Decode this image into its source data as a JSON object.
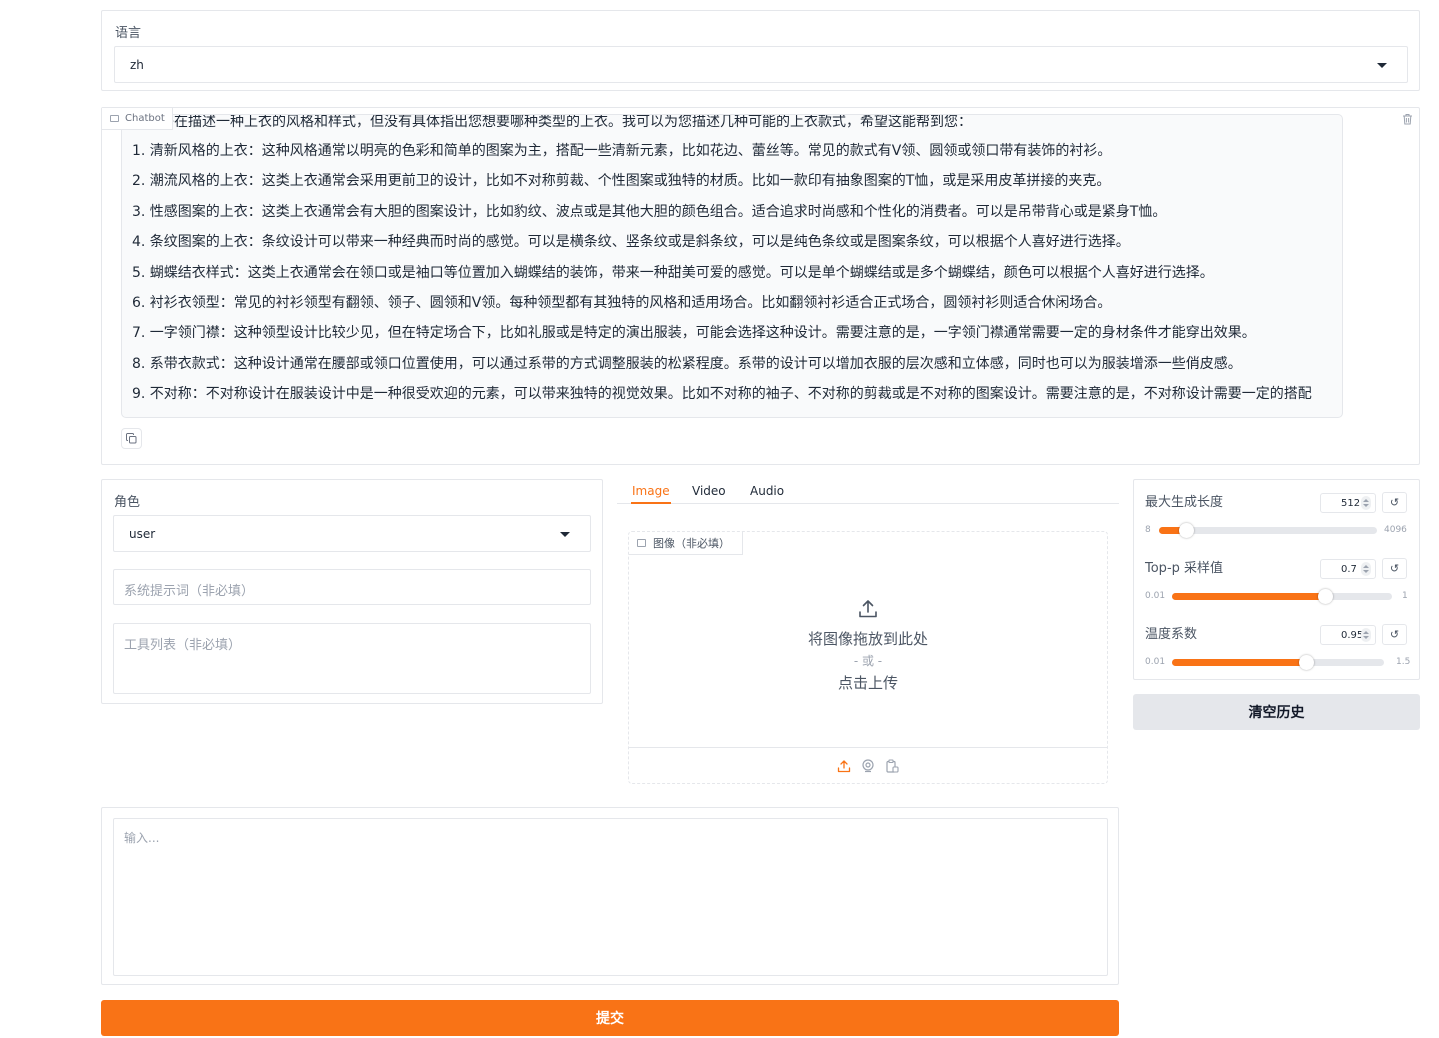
{
  "language": {
    "label": "语言",
    "value": "zh"
  },
  "chatbot": {
    "tag_label": "Chatbot",
    "intro": "您似乎在描述一种上衣的风格和样式，但没有具体指出您想要哪种类型的上衣。我可以为您描述几种可能的上衣款式，希望这能帮到您：",
    "lines": [
      "1. 清新风格的上衣：这种风格通常以明亮的色彩和简单的图案为主，搭配一些清新元素，比如花边、蕾丝等。常见的款式有V领、圆领或领口带有装饰的衬衫。",
      "2. 潮流风格的上衣：这类上衣通常会采用更前卫的设计，比如不对称剪裁、个性图案或独特的材质。比如一款印有抽象图案的T恤，或是采用皮革拼接的夹克。",
      "3. 性感图案的上衣：这类上衣通常会有大胆的图案设计，比如豹纹、波点或是其他大胆的颜色组合。适合追求时尚感和个性化的消费者。可以是吊带背心或是紧身T恤。",
      "4. 条纹图案的上衣：条纹设计可以带来一种经典而时尚的感觉。可以是横条纹、竖条纹或是斜条纹，可以是纯色条纹或是图案条纹，可以根据个人喜好进行选择。",
      "5. 蝴蝶结衣样式：这类上衣通常会在领口或是袖口等位置加入蝴蝶结的装饰，带来一种甜美可爱的感觉。可以是单个蝴蝶结或是多个蝴蝶结，颜色可以根据个人喜好进行选择。",
      "6. 衬衫衣领型：常见的衬衫领型有翻领、领子、圆领和V领。每种领型都有其独特的风格和适用场合。比如翻领衬衫适合正式场合，圆领衬衫则适合休闲场合。",
      "7. 一字领门襟：这种领型设计比较少见，但在特定场合下，比如礼服或是特定的演出服装，可能会选择这种设计。需要注意的是，一字领门襟通常需要一定的身材条件才能穿出效果。",
      "8. 系带衣款式：这种设计通常在腰部或领口位置使用，可以通过系带的方式调整服装的松紧程度。系带的设计可以增加衣服的层次感和立体感，同时也可以为服装增添一些俏皮感。",
      "9. 不对称：不对称设计在服装设计中是一种很受欢迎的元素，可以带来独特的视觉效果。比如不对称的袖子、不对称的剪裁或是不对称的图案设计。需要注意的是，不对称设计需要一定的搭配"
    ]
  },
  "role": {
    "label": "角色",
    "value": "user"
  },
  "system_prompt": {
    "placeholder": "系统提示词（非必填）"
  },
  "tools": {
    "placeholder": "工具列表（非必填）"
  },
  "media_tabs": [
    {
      "label": "Image",
      "active": true
    },
    {
      "label": "Video",
      "active": false
    },
    {
      "label": "Audio",
      "active": false
    }
  ],
  "image_upload": {
    "tag_label": "图像（非必填）",
    "drop_text": "将图像拖放到此处",
    "or_text": "- 或 -",
    "click_text": "点击上传"
  },
  "params": {
    "max_length": {
      "label": "最大生成长度",
      "value": "512",
      "min": "8",
      "max": "4096",
      "fraction": 0.123
    },
    "top_p": {
      "label": "Top-p 采样值",
      "value": "0.7",
      "min": "0.01",
      "max": "1",
      "fraction": 0.697
    },
    "temperature": {
      "label": "温度系数",
      "value": "0.95",
      "min": "0.01",
      "max": "1.5",
      "fraction": 0.631
    },
    "reset_glyph": "↺"
  },
  "clear_history_label": "清空历史",
  "input": {
    "placeholder": "输入..."
  },
  "submit_label": "提交",
  "colors": {
    "accent": "#f97316",
    "border": "#e5e7eb",
    "secondary_button": "#e5e7eb"
  }
}
